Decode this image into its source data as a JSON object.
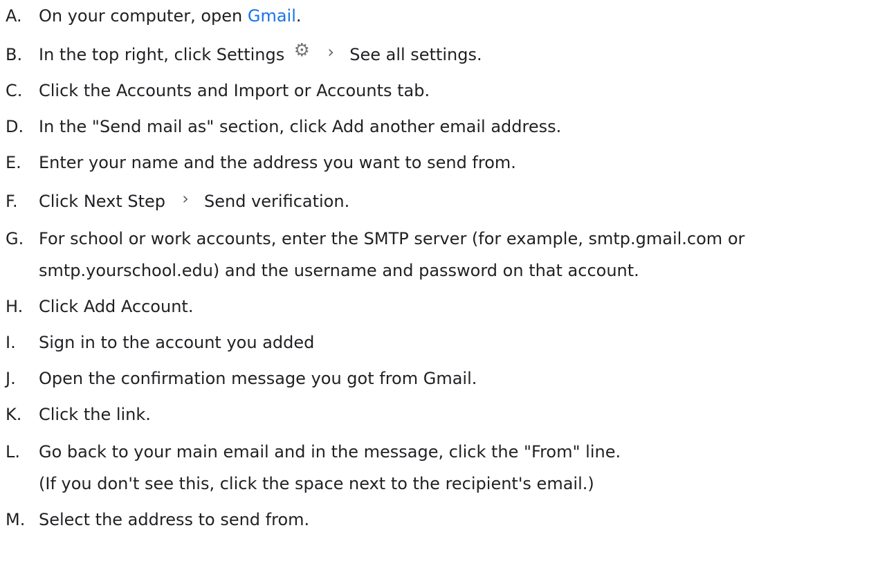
{
  "steps": [
    {
      "marker": "A.",
      "pre": "On your computer, open ",
      "link": "Gmail",
      "post": "."
    },
    {
      "marker": "B.",
      "pre": "In the top right, click Settings",
      "icon1": "gear-icon",
      "icon2": "chevron-right-icon",
      "post": "See all settings."
    },
    {
      "marker": "C.",
      "text": "Click the Accounts and Import or Accounts tab."
    },
    {
      "marker": "D.",
      "text": "In the \"Send mail as\" section, click Add another email address."
    },
    {
      "marker": "E.",
      "text": "Enter your name and the address you want to send from."
    },
    {
      "marker": "F.",
      "pre": "Click Next Step",
      "icon1": "chevron-right-icon",
      "post": "Send verification."
    },
    {
      "marker": "G.",
      "line1": "For school or work accounts, enter the SMTP server (for example, smtp.gmail.com or",
      "line2": "smtp.yourschool.edu) and the username and password on that account."
    },
    {
      "marker": "H.",
      "text": "Click Add Account."
    },
    {
      "marker": "I.",
      "text": "Sign in to the account you added"
    },
    {
      "marker": "J.",
      "text": "Open the confirmation message you got from Gmail."
    },
    {
      "marker": "K.",
      "text": "Click the link."
    },
    {
      "marker": "L.",
      "line1": "Go back to your main email and in the message, click the \"From\" line.",
      "line2": "(If you don't see this, click the space next to the recipient's email.)"
    },
    {
      "marker": "M.",
      "text": "Select the address to send from."
    }
  ],
  "colors": {
    "text": "#202124",
    "link": "#1a73e8",
    "icon": "#757575"
  }
}
